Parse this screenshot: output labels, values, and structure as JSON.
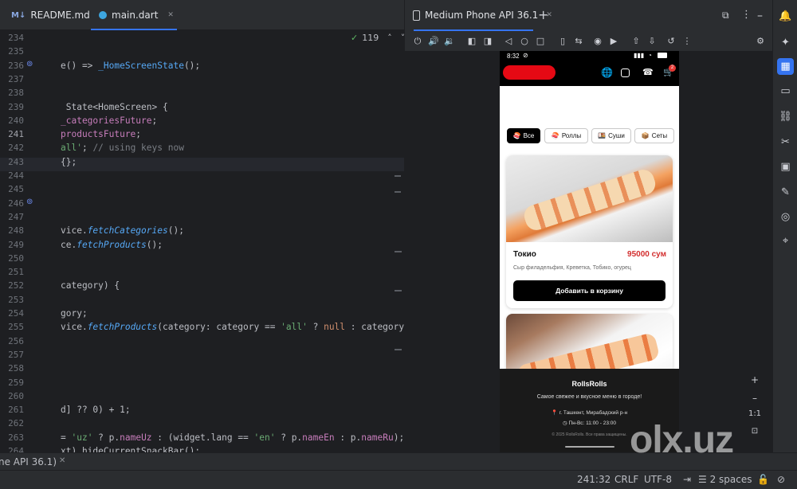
{
  "tabs": [
    {
      "icon": "M↓",
      "label": "README.md"
    },
    {
      "label": "main.dart",
      "close": "✕"
    }
  ],
  "editor": {
    "inspection_count": "119",
    "lines": [
      {
        "n": "234",
        "html": ""
      },
      {
        "n": "235",
        "html": ""
      },
      {
        "n": "236",
        "html": "e() => <span class=cls>_HomeScreenState</span>();"
      },
      {
        "n": "237",
        "html": ""
      },
      {
        "n": "238",
        "html": ""
      },
      {
        "n": "239",
        "html": " State&lt;HomeScreen&gt; {"
      },
      {
        "n": "240",
        "html": "<span class=fld>_categoriesFuture</span>;"
      },
      {
        "n": "241",
        "html": "<span class=fld>productsFuture</span>;"
      },
      {
        "n": "242",
        "html": "<span class=str>all'</span>; <span class=cmt>// using keys now</span>"
      },
      {
        "n": "243",
        "html": "{};"
      },
      {
        "n": "244",
        "html": ""
      },
      {
        "n": "245",
        "html": ""
      },
      {
        "n": "246",
        "html": ""
      },
      {
        "n": "247",
        "html": ""
      },
      {
        "n": "248",
        "html": "vice.<span class=fn>fetchCategories</span>();"
      },
      {
        "n": "249",
        "html": "ce.<span class=fn>fetchProducts</span>();"
      },
      {
        "n": "250",
        "html": ""
      },
      {
        "n": "251",
        "html": ""
      },
      {
        "n": "252",
        "html": "category) {"
      },
      {
        "n": "253",
        "html": ""
      },
      {
        "n": "254",
        "html": "gory;"
      },
      {
        "n": "255",
        "html": "vice.<span class=fn>fetchProducts</span>(category: category == <span class=str>'all'</span> ? <span class=kw>null</span> : category);"
      },
      {
        "n": "256",
        "html": ""
      },
      {
        "n": "257",
        "html": ""
      },
      {
        "n": "258",
        "html": ""
      },
      {
        "n": "259",
        "html": ""
      },
      {
        "n": "260",
        "html": ""
      },
      {
        "n": "261",
        "html": "d] ?? 0) + 1;"
      },
      {
        "n": "262",
        "html": ""
      },
      {
        "n": "263",
        "html": "= <span class=str>'uz'</span> ? p.<span class=fld>nameUz</span> : (widget.lang == <span class=str>'en'</span> ? p.<span class=fld>nameEn</span> : p.<span class=fld>nameRu</span>);"
      },
      {
        "n": "264",
        "html": "xt).hideCurrentSnackBar();"
      }
    ]
  },
  "emulator": {
    "title": "Medium Phone API 36.1",
    "zoom": "1:1",
    "phone": {
      "time": "8:32",
      "cart_badge": "2",
      "categories": [
        {
          "icon": "🍣",
          "label": "Все"
        },
        {
          "icon": "🍣",
          "label": "Роллы"
        },
        {
          "icon": "🍱",
          "label": "Суши"
        },
        {
          "icon": "📦",
          "label": "Сеты"
        }
      ],
      "product": {
        "name": "Токио",
        "price": "95000 сум",
        "desc": "Сыр филадельфия, Креветка, Тобико, огурец",
        "button": "Добавить в корзину"
      },
      "footer": {
        "brand": "RollsRolls",
        "tagline": "Самое свежее и вкусное меню в городе!",
        "address": "г. Ташкент, Мирабадский р-н",
        "hours": "Пн-Вс: 11:00 - 23:00",
        "copyright": "© 2025 RollsRolls. Все права защищены."
      }
    }
  },
  "status": {
    "run_tab": "ne API 36.1)",
    "position": "241:32",
    "line_sep": "CRLF",
    "encoding": "UTF-8",
    "indent": "2 spaces"
  },
  "watermark": "olx.uz",
  "colors": {
    "accent": "#3574f0",
    "price": "#d32f2f",
    "brand_red": "#e50914"
  }
}
